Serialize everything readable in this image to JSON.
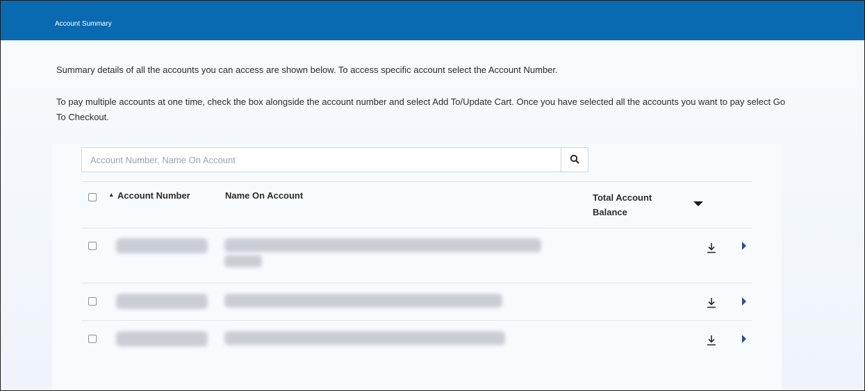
{
  "header": {
    "title": "Account Summary"
  },
  "intro": {
    "line1": "Summary details of all the accounts you can access are shown below. To access specific account select the Account Number.",
    "line2": "To pay multiple accounts at one time, check the box alongside the account number and select Add To/Update Cart. Once you have selected all the accounts you want to pay select Go To Checkout."
  },
  "search": {
    "placeholder": "Account Number, Name On Account",
    "value": "",
    "icon": "search-icon"
  },
  "table": {
    "columns": {
      "account_number": "Account Number",
      "name_on_account": "Name On Account",
      "total_account_balance": "Total Account Balance"
    },
    "sort_indicator": "▴",
    "rows": [
      {
        "account_number": "",
        "name_on_account": "",
        "balance": ""
      },
      {
        "account_number": "",
        "name_on_account": "",
        "balance": ""
      },
      {
        "account_number": "",
        "name_on_account": "",
        "balance": ""
      }
    ]
  },
  "colors": {
    "header_bar": "#0a6ab1",
    "row_arrow": "#2f4d8f"
  }
}
